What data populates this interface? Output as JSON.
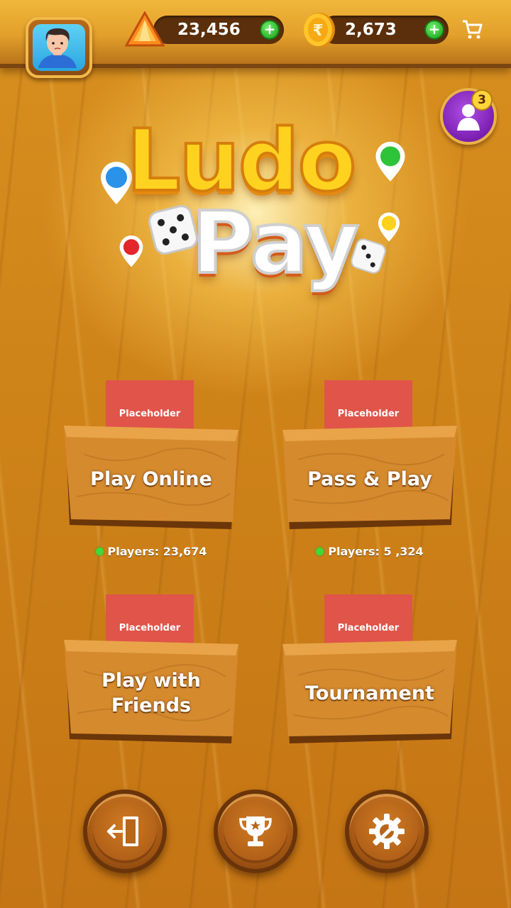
{
  "header": {
    "gems": {
      "value": "23,456",
      "icon": "gem-icon",
      "add_icon": "plus-icon"
    },
    "coins": {
      "value": "2,673",
      "icon": "rupee-coin-icon",
      "add_icon": "plus-icon"
    },
    "shop_icon": "cart-icon",
    "avatar_icon": "player-avatar-icon"
  },
  "friends": {
    "badge_count": "3",
    "icon": "friend-icon"
  },
  "logo": {
    "line1": "Ludo",
    "line2": "Pay"
  },
  "modes": [
    {
      "placeholder": "Placeholder",
      "label": "Play Online",
      "players": "Players: 23,674"
    },
    {
      "placeholder": "Placeholder",
      "label": "Pass & Play",
      "players": "Players: 5 ,324"
    },
    {
      "placeholder": "Placeholder",
      "label": "Play with Friends"
    },
    {
      "placeholder": "Placeholder",
      "label": "Tournament"
    }
  ],
  "footer": {
    "exit_icon": "exit-door-icon",
    "trophy_icon": "trophy-icon",
    "settings_icon": "settings-gear-icon"
  },
  "colors": {
    "wood": "#cf8419",
    "placeholder_red": "#e0544a",
    "online_green": "#3fd93a",
    "badge_purple": "#7a1fb0"
  }
}
